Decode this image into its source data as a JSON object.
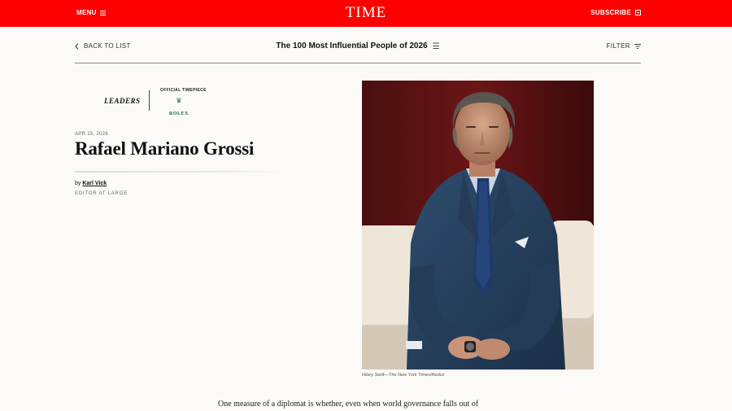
{
  "header": {
    "menu_label": "MENU",
    "logo_text": "TIME",
    "subscribe_label": "SUBSCRIBE",
    "brand_color": "#ff0000"
  },
  "listbar": {
    "back_label": "BACK TO LIST",
    "list_title": "The 100 Most Influential People of 2026",
    "filter_label": "FILTER"
  },
  "profile": {
    "category": "LEADERS",
    "sponsor_label": "OFFICIAL TIMEPIECE",
    "sponsor_name": "ROLEX",
    "date": "APR 15, 2026",
    "name": "Rafael Mariano Grossi",
    "byline_prefix": "by",
    "author": "Karl Vick",
    "author_role": "EDITOR AT LARGE"
  },
  "photo": {
    "credit": "Hilary Swift—The New York Times/Redux"
  },
  "article": {
    "first_line": "One measure of a diplomat is whether, even when world governance falls out of"
  },
  "icons": {
    "menu": "hamburger-icon",
    "subscribe": "subscribe-icon",
    "back": "chevron-left-icon",
    "list": "list-icon",
    "filter": "filter-icon",
    "sponsor": "crown-icon"
  }
}
